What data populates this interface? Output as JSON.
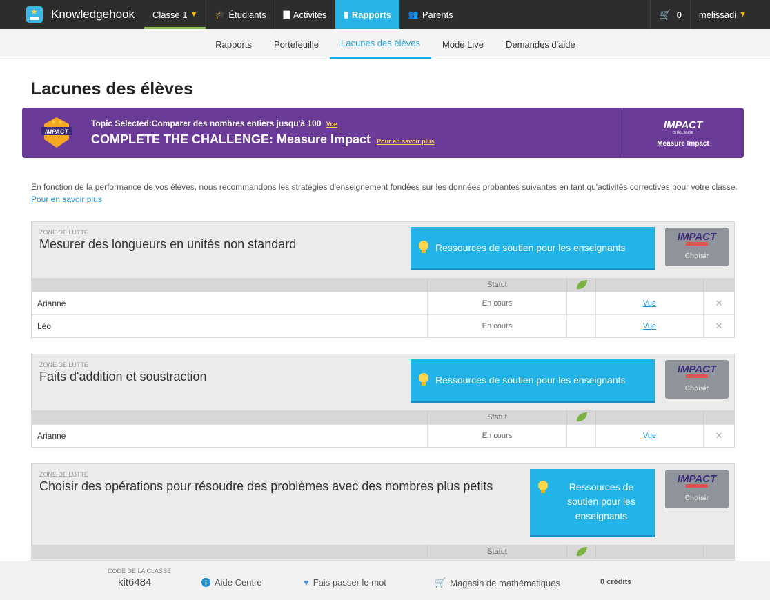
{
  "topbar": {
    "brand": "Knowledgehook",
    "classe": "Classe 1",
    "etudiants": "Étudiants",
    "activites": "Activités",
    "rapports": "Rapports",
    "parents": "Parents",
    "cart_count": "0",
    "user": "melissadi"
  },
  "subnav": {
    "tabs": [
      "Rapports",
      "Portefeuille",
      "Lacunes des élèves",
      "Mode Live",
      "Demandes d'aide"
    ],
    "active": "Lacunes des élèves"
  },
  "page": {
    "title": "Lacunes des élèves"
  },
  "banner": {
    "topic_prefix": "Topic Selected:",
    "topic": "Comparer des nombres entiers jusqu'à 100",
    "topic_link": "Vue",
    "challenge": "COMPLETE THE CHALLENGE: Measure Impact",
    "learn_more": "Pour en savoir plus",
    "right_label": "Measure Impact",
    "logo_text": "IMPACT",
    "logo_sub": "CHALLENGE"
  },
  "intro": {
    "text": "En fonction de la performance de vos élèves, nous recommandons les stratégies d'enseignement fondées sur les données probantes suivantes en tant qu'activités correctives pour votre classe.",
    "link": "Pour en savoir plus"
  },
  "zones": [
    {
      "label": "ZONE DE LUTTE",
      "title": "Mesurer des longueurs en unités non standard",
      "resources": "Ressources de soutien pour les enseignants",
      "choose": "Choisir",
      "status_header": "Statut",
      "rows": [
        {
          "name": "Arianne",
          "status": "En cours",
          "link": "Vue"
        },
        {
          "name": "Léo",
          "status": "En cours",
          "link": "Vue"
        }
      ]
    },
    {
      "label": "ZONE DE LUTTE",
      "title": "Faits d'addition et soustraction",
      "resources": "Ressources de soutien pour les enseignants",
      "choose": "Choisir",
      "status_header": "Statut",
      "rows": [
        {
          "name": "Arianne",
          "status": "En cours",
          "link": "Vue"
        }
      ]
    },
    {
      "label": "ZONE DE LUTTE",
      "title": "Choisir des opérations pour résoudre des problèmes avec des nombres plus petits",
      "resources": "Ressources de soutien pour les enseignants",
      "choose": "Choisir",
      "status_header": "Statut",
      "rows": []
    }
  ],
  "footer": {
    "code_label": "CODE DE LA CLASSE",
    "code": "kit6484",
    "aide": "Aide Centre",
    "share": "Fais passer le mot",
    "shop": "Magasin de mathématiques",
    "credits": "0 crédits"
  },
  "colors": {
    "topbar": "#2d2d2d",
    "accent_blue": "#28b4e6",
    "banner_purple": "#6a3b97",
    "leaf_green": "#8bc34a"
  }
}
